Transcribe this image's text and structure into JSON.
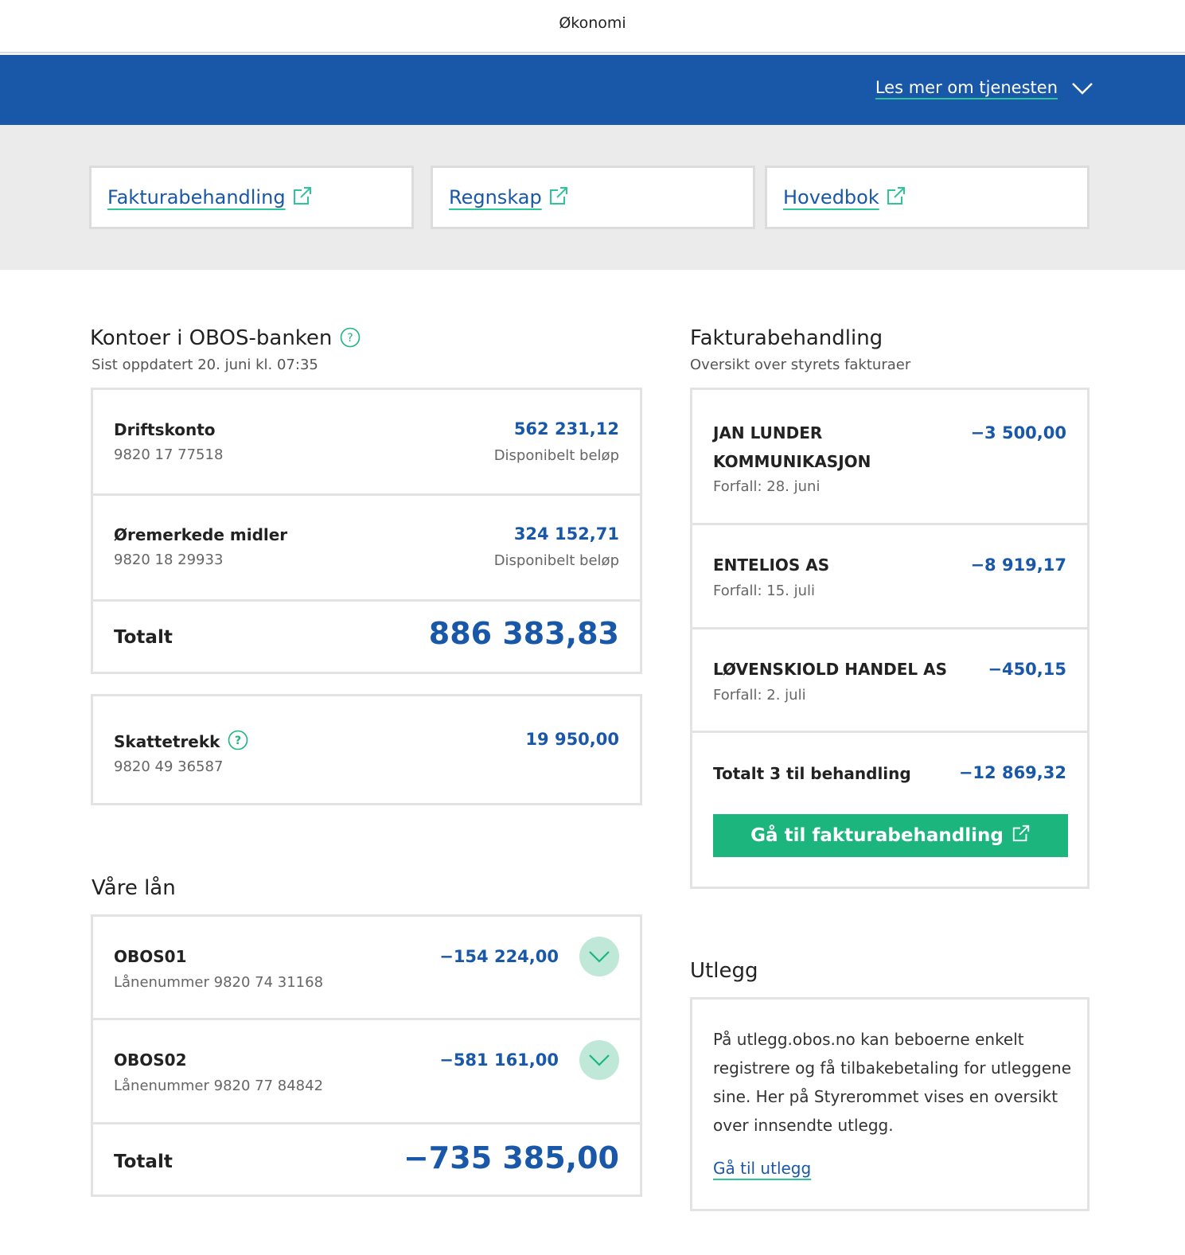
{
  "page": {
    "title": "Økonomi"
  },
  "header": {
    "read_more": "Les mer om tjenesten",
    "chevron_icon": "chevron-down-icon"
  },
  "quick_links": [
    {
      "label": "Fakturabehandling",
      "icon": "external-link-icon"
    },
    {
      "label": "Regnskap",
      "icon": "external-link-icon"
    },
    {
      "label": "Hovedbok",
      "icon": "external-link-icon"
    }
  ],
  "accounts": {
    "heading": "Kontoer i OBOS-banken",
    "updated": "Sist oppdatert 20. juni kl. 07:35",
    "items": [
      {
        "name": "Driftskonto",
        "number": "9820 17 77518",
        "amount": "562 231,12",
        "amount_label": "Disponibelt beløp"
      },
      {
        "name": "Øremerkede midler",
        "number": "9820 18 29933",
        "amount": "324 152,71",
        "amount_label": "Disponibelt beløp"
      }
    ],
    "total_label": "Totalt",
    "total_amount": "886 383,83",
    "tax": {
      "name": "Skattetrekk",
      "number": "9820 49 36587",
      "amount": "19 950,00"
    }
  },
  "loans": {
    "heading": "Våre lån",
    "items": [
      {
        "name": "OBOS01",
        "number": "Lånenummer 9820 74 31168",
        "amount": "−154 224,00"
      },
      {
        "name": "OBOS02",
        "number": "Lånenummer 9820 77 84842",
        "amount": "−581 161,00"
      }
    ],
    "total_label": "Totalt",
    "total_amount": "−735 385,00"
  },
  "invoices": {
    "heading": "Fakturabehandling",
    "subheading": "Oversikt over styrets fakturaer",
    "items": [
      {
        "name": "JAN LUNDER KOMMUNIKASJON",
        "due": "Forfall: 28. juni",
        "amount": "−3 500,00"
      },
      {
        "name": "ENTELIOS AS",
        "due": "Forfall: 15. juli",
        "amount": "−8 919,17"
      },
      {
        "name": "LØVENSKIOLD HANDEL AS",
        "due": "Forfall: 2. juli",
        "amount": "−450,15"
      }
    ],
    "total_label": "Totalt 3 til behandling",
    "total_amount": "−12 869,32",
    "button": "Gå til fakturabehandling"
  },
  "expenses": {
    "heading": "Utlegg",
    "text": "På utlegg.obos.no kan beboerne enkelt registrere og få tilbakebetaling for utleggene sine. Her på Styrerommet vises en oversikt over innsendte utlegg.",
    "link": "Gå til utlegg"
  },
  "colors": {
    "brand_blue": "#1958a8",
    "accent_green": "#1cb57e",
    "light_green": "#bfe8d9"
  }
}
